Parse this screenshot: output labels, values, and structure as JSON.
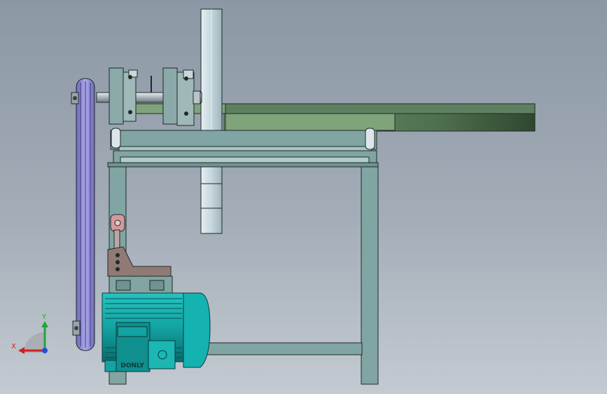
{
  "scene": {
    "background_top": "#8b97a4",
    "background_bottom": "#c4cad1",
    "frame_color": "#80a5a3",
    "frame_dark": "#1e2b2a",
    "rail_color": "#708f6a",
    "disc_color": "#c5d6dc",
    "belt_color": "#a9a4e4",
    "motor_color": "#13a6a5",
    "bracket_color": "#927a74",
    "link_color": "#d49a9a"
  },
  "motor": {
    "nameplate": "DONLY"
  },
  "triad": {
    "x_label": "X",
    "y_label": "Y",
    "x_color": "#d02020",
    "y_color": "#1ea63a",
    "z_color": "#2a4fd4"
  }
}
